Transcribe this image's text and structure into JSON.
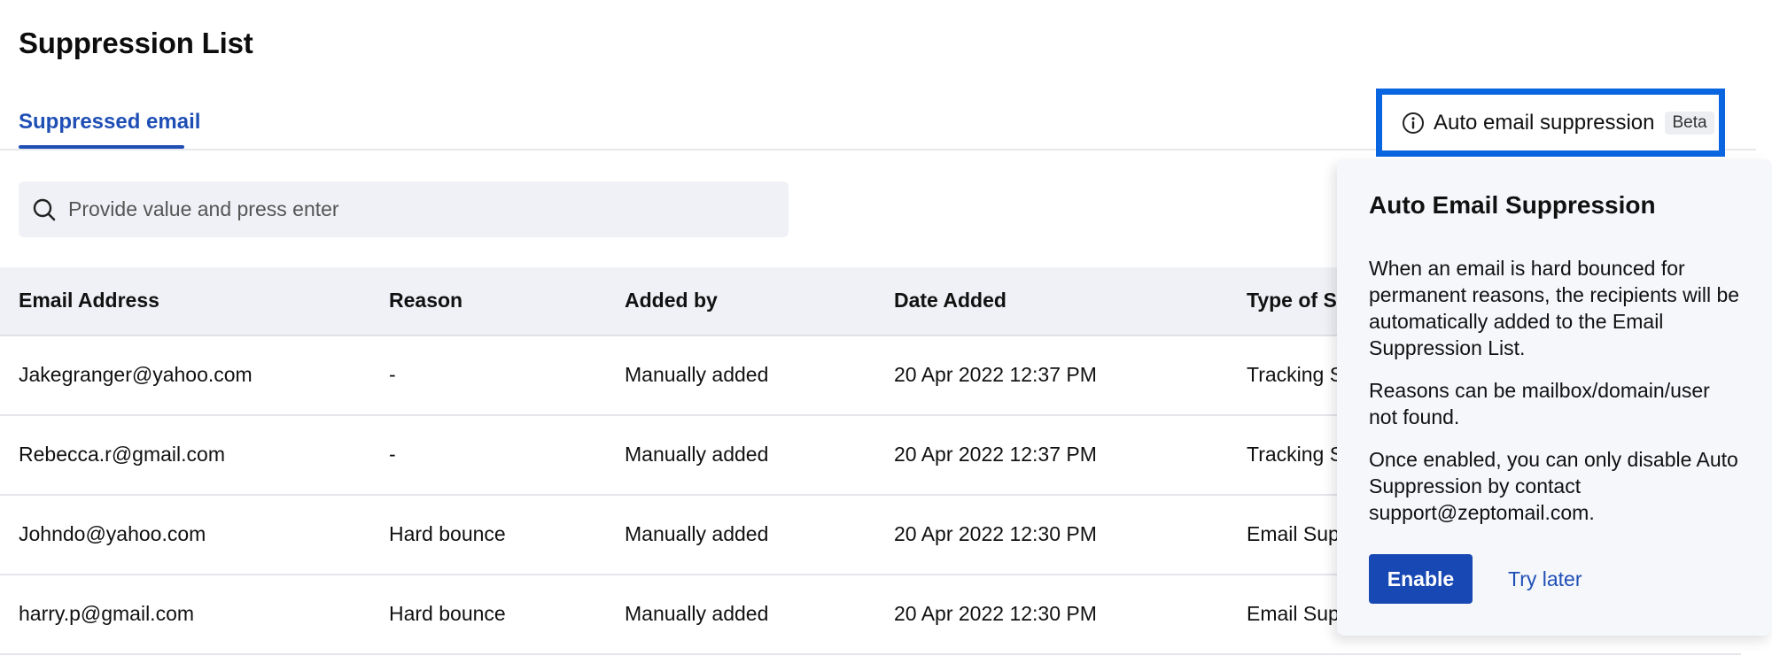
{
  "page": {
    "title": "Suppression List"
  },
  "tabs": [
    {
      "label": "Suppressed email",
      "active": true
    }
  ],
  "auto_suppression_button": {
    "label": "Auto email suppression",
    "badge": "Beta",
    "icon": "info-icon"
  },
  "search": {
    "placeholder": "Provide value and press enter",
    "value": "",
    "icon": "search-icon"
  },
  "table": {
    "columns": [
      "Email Address",
      "Reason",
      "Added by",
      "Date Added",
      "Type of Su"
    ],
    "rows": [
      {
        "email": "Jakegranger@yahoo.com",
        "reason": "-",
        "added_by": "Manually added",
        "date": "20 Apr 2022 12:37 PM",
        "type": "Tracking S"
      },
      {
        "email": "Rebecca.r@gmail.com",
        "reason": "-",
        "added_by": "Manually added",
        "date": "20 Apr 2022 12:37 PM",
        "type": "Tracking S"
      },
      {
        "email": "Johndo@yahoo.com",
        "reason": "Hard bounce",
        "added_by": "Manually added",
        "date": "20 Apr 2022 12:30 PM",
        "type": "Email Sup"
      },
      {
        "email": "harry.p@gmail.com",
        "reason": "Hard bounce",
        "added_by": "Manually added",
        "date": "20 Apr 2022 12:30 PM",
        "type": "Email Sup"
      }
    ]
  },
  "popover": {
    "title": "Auto Email Suppression",
    "paragraphs": [
      "When an email is hard bounced for permanent reasons, the recipients will be automatically added to the Email Suppression List.",
      "Reasons can be mailbox/domain/user not found.",
      "Once enabled, you can only disable Auto Suppression by contact support@zeptomail.com."
    ],
    "enable_label": "Enable",
    "try_later_label": "Try later"
  },
  "colors": {
    "accent": "#1f4fb5",
    "highlight_border": "#0a66e0",
    "primary_button": "#1848b3",
    "header_bg": "#eff1f6"
  }
}
